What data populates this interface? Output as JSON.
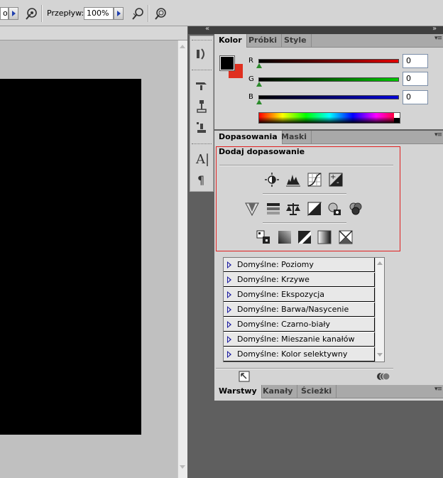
{
  "options_bar": {
    "mode_value": "o",
    "flow_label": "Przepływ:",
    "flow_value": "100%"
  },
  "color_panel": {
    "tabs": [
      "Kolor",
      "Próbki",
      "Style"
    ],
    "channels": [
      {
        "label": "R",
        "value": "0",
        "color": "#e00000"
      },
      {
        "label": "G",
        "value": "0",
        "color": "#00c800"
      },
      {
        "label": "B",
        "value": "0",
        "color": "#0000d8"
      }
    ],
    "foreground": "#000000",
    "background": "#e03020"
  },
  "adjustments_panel": {
    "tabs": [
      "Dopasowania",
      "Maski"
    ],
    "heading": "Dodaj dopasowanie",
    "presets": [
      "Domyślne: Poziomy",
      "Domyślne: Krzywe",
      "Domyślne: Ekspozycja",
      "Domyślne: Barwa/Nasycenie",
      "Domyślne: Czarno-biały",
      "Domyślne: Mieszanie kanałów",
      "Domyślne: Kolor selektywny"
    ]
  },
  "layers_panel": {
    "tabs": [
      "Warstwy",
      "Kanały",
      "Ścieżki"
    ]
  },
  "icons": [
    "airbrush-icon",
    "brightness-icon",
    "levels-icon",
    "curves-icon",
    "exposure-icon",
    "vibrance-icon",
    "hue-sat-icon",
    "balance-icon",
    "bw-icon",
    "photo-filter-icon",
    "channel-mixer-icon",
    "invert-icon",
    "posterize-icon",
    "threshold-icon",
    "gradient-map-icon",
    "selective-color-icon"
  ]
}
